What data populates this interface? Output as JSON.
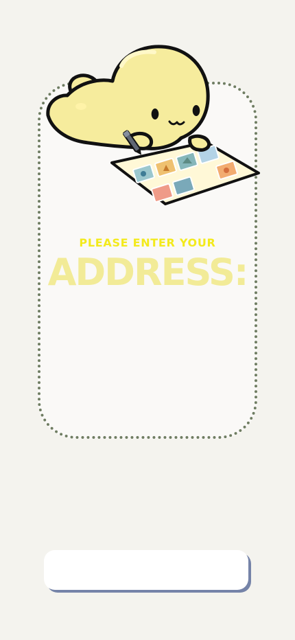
{
  "form": {
    "eyebrow": "PLEASE ENTER YOUR",
    "headline": "ADDRESS:",
    "address_value": "",
    "address_placeholder": ""
  },
  "icons": {
    "mascot": "mascot-writing-on-stamp-sheet-icon"
  },
  "colors": {
    "background": "#f4f3ee",
    "card_fill": "#faf9f7",
    "card_border": "#6f7d62",
    "eyebrow_text": "#f3ea1c",
    "headline_text": "#f2eb97",
    "input_shadow": "#7583a8",
    "mascot_body": "#f6ec9d",
    "outline": "#111111"
  }
}
